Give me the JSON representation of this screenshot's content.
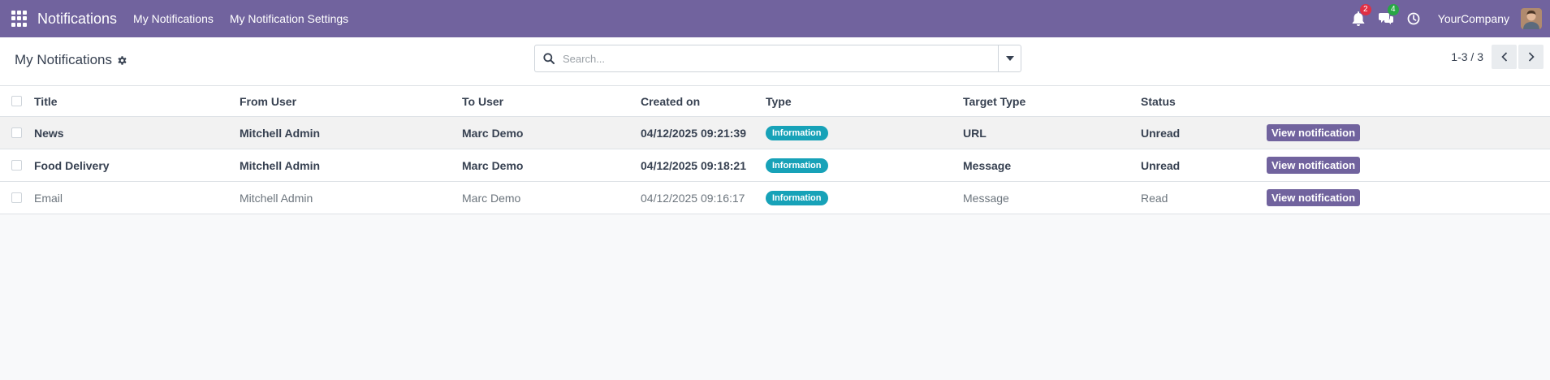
{
  "navbar": {
    "app_name": "Notifications",
    "menu": [
      "My Notifications",
      "My Notification Settings"
    ],
    "activity_count": "2",
    "messages_count": "4",
    "company": "YourCompany",
    "colors": {
      "navbar": "#71639e",
      "badge_red": "#e02f44",
      "badge_green": "#28a745"
    }
  },
  "control_panel": {
    "title": "My Notifications",
    "search_placeholder": "Search...",
    "pager": "1-3 / 3"
  },
  "table": {
    "columns": [
      "Title",
      "From User",
      "To User",
      "Created on",
      "Type",
      "Target Type",
      "Status"
    ],
    "rows": [
      {
        "title": "News",
        "from_user": "Mitchell Admin",
        "to_user": "Marc Demo",
        "created_on": "04/12/2025 09:21:39",
        "type": "Information",
        "target_type": "URL",
        "status": "Unread",
        "action": "View notification"
      },
      {
        "title": "Food Delivery",
        "from_user": "Mitchell Admin",
        "to_user": "Marc Demo",
        "created_on": "04/12/2025 09:18:21",
        "type": "Information",
        "target_type": "Message",
        "status": "Unread",
        "action": "View notification"
      },
      {
        "title": "Email",
        "from_user": "Mitchell Admin",
        "to_user": "Marc Demo",
        "created_on": "04/12/2025 09:16:17",
        "type": "Information",
        "target_type": "Message",
        "status": "Read",
        "action": "View notification"
      }
    ],
    "colors": {
      "type_badge": "#17a2b8",
      "action_button": "#71639e"
    }
  }
}
